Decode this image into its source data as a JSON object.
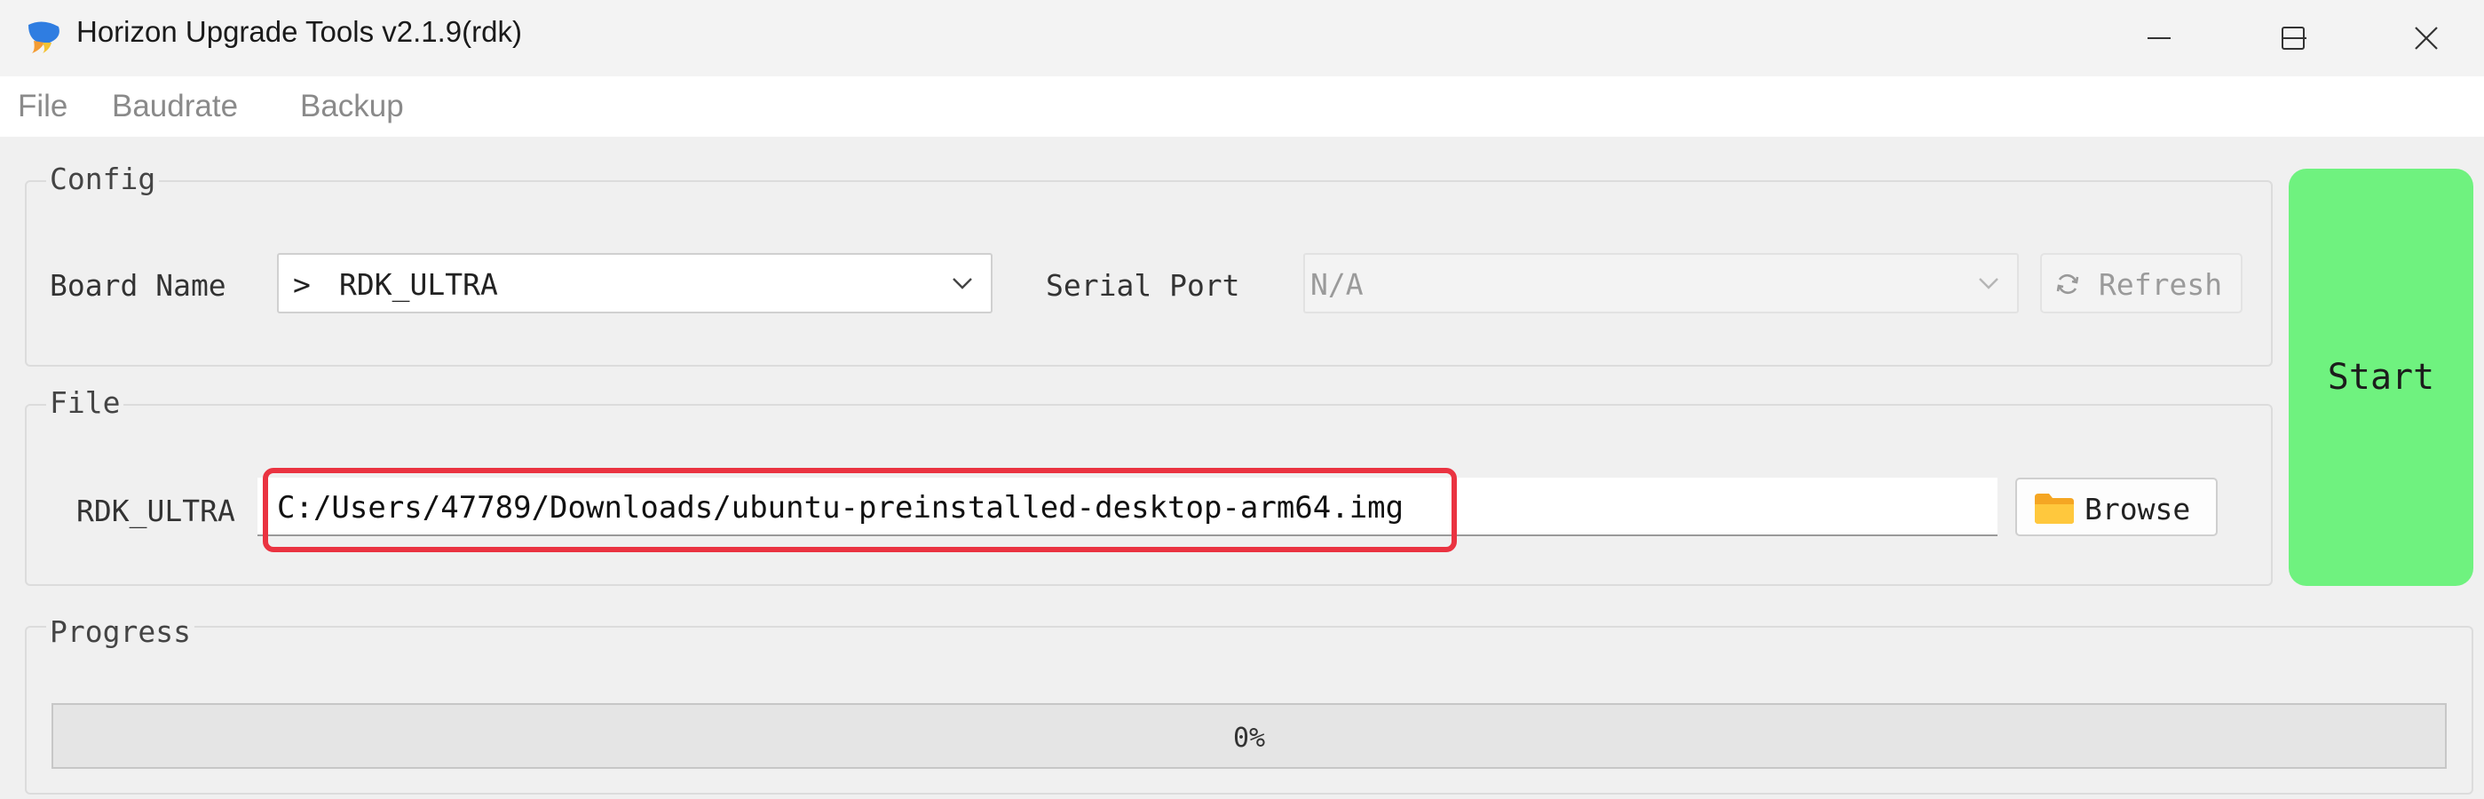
{
  "window": {
    "title": "Horizon Upgrade Tools v2.1.9(rdk)",
    "icons": {
      "app": "app-logo-icon",
      "minimize": "minimize-icon",
      "maximize": "maximize-icon",
      "close": "close-icon"
    }
  },
  "menu": [
    "File",
    "Baudrate",
    "Backup"
  ],
  "config": {
    "title": "Config",
    "board_label": "Board Name",
    "board_prefix": ">",
    "board_value": "RDK_ULTRA",
    "serial_label": "Serial Port",
    "serial_value": "N/A",
    "refresh_label": "Refresh"
  },
  "file": {
    "title": "File",
    "row_label": "RDK_ULTRA",
    "path_value": "C:/Users/47789/Downloads/ubuntu-preinstalled-desktop-arm64.img",
    "browse_label": "Browse",
    "folder_icon": "folder-icon"
  },
  "start_label": "Start",
  "progress": {
    "title": "Progress",
    "value": 0,
    "text": "0%"
  },
  "colors": {
    "start": "#6ff27f",
    "highlight": "#ea3341"
  }
}
